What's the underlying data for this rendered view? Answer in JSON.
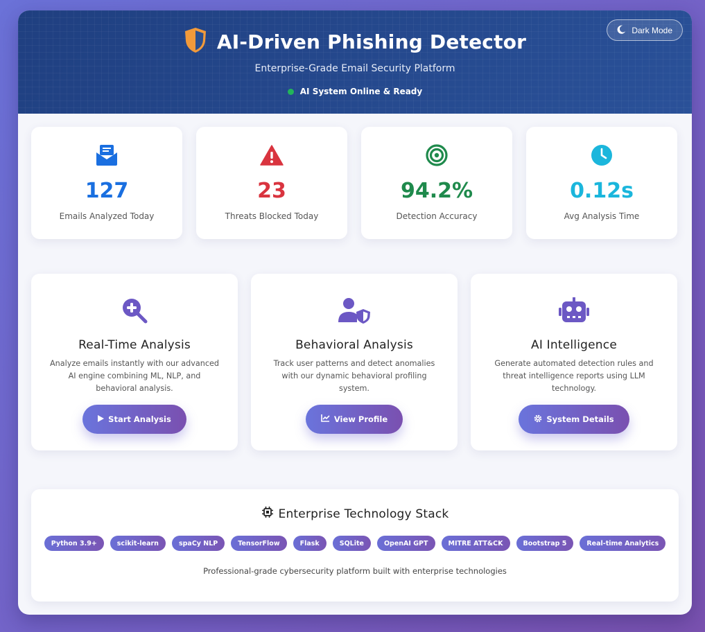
{
  "header": {
    "title": "AI-Driven Phishing Detector",
    "subtitle": "Enterprise-Grade Email Security Platform",
    "status": "AI System Online & Ready",
    "dark_mode_label": "Dark Mode",
    "logo_icon": "shield-icon",
    "colors": {
      "status_dot": "#22b45a",
      "header_bg": "#1f3f80"
    }
  },
  "stats": [
    {
      "icon": "envelope-icon",
      "value": "127",
      "label": "Emails Analyzed Today",
      "color": "#1a6fe0"
    },
    {
      "icon": "warning-icon",
      "value": "23",
      "label": "Threats Blocked Today",
      "color": "#d9343f"
    },
    {
      "icon": "target-icon",
      "value": "94.2%",
      "label": "Detection Accuracy",
      "color": "#1f8a4c"
    },
    {
      "icon": "clock-icon",
      "value": "0.12s",
      "label": "Avg Analysis Time",
      "color": "#1bb6dc"
    }
  ],
  "features": [
    {
      "icon": "search-plus-icon",
      "title": "Real-Time Analysis",
      "desc": "Analyze emails instantly with our advanced AI engine combining ML, NLP, and behavioral analysis.",
      "button": "Start Analysis",
      "button_icon": "play-icon"
    },
    {
      "icon": "user-shield-icon",
      "title": "Behavioral Analysis",
      "desc": "Track user patterns and detect anomalies with our dynamic behavioral profiling system.",
      "button": "View Profile",
      "button_icon": "chart-line-icon"
    },
    {
      "icon": "robot-icon",
      "title": "AI Intelligence",
      "desc": "Generate automated detection rules and threat intelligence reports using LLM technology.",
      "button": "System Details",
      "button_icon": "cog-icon"
    }
  ],
  "tech": {
    "title": "Enterprise Technology Stack",
    "icon": "microchip-icon",
    "chips": [
      "Python 3.9+",
      "scikit-learn",
      "spaCy NLP",
      "TensorFlow",
      "Flask",
      "SQLite",
      "OpenAI GPT",
      "MITRE ATT&CK",
      "Bootstrap 5",
      "Real-time Analytics"
    ],
    "footer": "Professional-grade cybersecurity platform built with enterprise technologies"
  },
  "accent_color": "#6c63c9"
}
